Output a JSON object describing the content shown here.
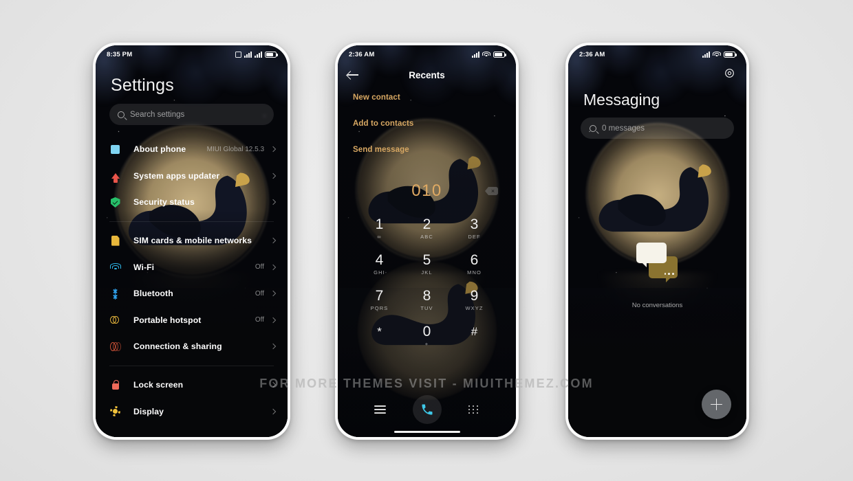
{
  "watermark": "FOR MORE THEMES VISIT - MIUITHEMEZ.COM",
  "settings_phone": {
    "status": {
      "time": "8:35 PM",
      "sim_icon": "sim-card-icon",
      "signal1": "signal-bars-icon",
      "signal2": "signal-bars-icon",
      "battery": "battery-icon"
    },
    "title": "Settings",
    "search": {
      "placeholder": "Search settings",
      "icon": "search-icon"
    },
    "items": [
      {
        "label": "About phone",
        "value": "MIUI Global 12.5.3",
        "icon": "about-phone-icon"
      },
      {
        "label": "System apps updater",
        "value": "",
        "icon": "system-update-icon"
      },
      {
        "label": "Security status",
        "value": "",
        "icon": "security-shield-icon"
      },
      {
        "label": "SIM cards & mobile networks",
        "value": "",
        "icon": "sim-card-icon"
      },
      {
        "label": "Wi-Fi",
        "value": "Off",
        "icon": "wifi-icon"
      },
      {
        "label": "Bluetooth",
        "value": "Off",
        "icon": "bluetooth-icon"
      },
      {
        "label": "Portable hotspot",
        "value": "Off",
        "icon": "hotspot-icon"
      },
      {
        "label": "Connection & sharing",
        "value": "",
        "icon": "connection-sharing-icon"
      },
      {
        "label": "Lock screen",
        "value": "",
        "icon": "lock-icon"
      },
      {
        "label": "Display",
        "value": "",
        "icon": "display-brightness-icon"
      }
    ]
  },
  "dialer_phone": {
    "status": {
      "time": "2:36 AM",
      "signal": "signal-bars-icon",
      "wifi": "wifi-icon",
      "battery": "battery-icon"
    },
    "header": {
      "title": "Recents",
      "back_icon": "back-arrow-icon"
    },
    "actions": [
      "New contact",
      "Add to contacts",
      "Send message"
    ],
    "number": "010",
    "backspace_icon": "backspace-icon",
    "keys": [
      {
        "digit": "1",
        "letters": "∞"
      },
      {
        "digit": "2",
        "letters": "ABC"
      },
      {
        "digit": "3",
        "letters": "DEF"
      },
      {
        "digit": "4",
        "letters": "GHI"
      },
      {
        "digit": "5",
        "letters": "JKL"
      },
      {
        "digit": "6",
        "letters": "MNO"
      },
      {
        "digit": "7",
        "letters": "PQRS"
      },
      {
        "digit": "8",
        "letters": "TUV"
      },
      {
        "digit": "9",
        "letters": "WXYZ"
      },
      {
        "digit": "*",
        "letters": ""
      },
      {
        "digit": "0",
        "letters": "+"
      },
      {
        "digit": "#",
        "letters": ""
      }
    ],
    "nav": {
      "menu_icon": "menu-lines-icon",
      "call_icon": "phone-call-icon",
      "keypad_icon": "keypad-grid-icon"
    }
  },
  "messaging_phone": {
    "status": {
      "time": "2:36 AM",
      "signal": "signal-bars-icon",
      "wifi": "wifi-icon",
      "battery": "battery-icon"
    },
    "settings_icon": "gear-icon",
    "title": "Messaging",
    "search": {
      "placeholder": "0 messages",
      "icon": "search-icon"
    },
    "empty_state": {
      "text": "No conversations",
      "icon": "chat-bubbles-icon"
    },
    "fab": {
      "icon": "plus-icon",
      "label": "New conversation"
    }
  },
  "colors": {
    "background": "#e9e9e9",
    "accent_gold": "#d8a863",
    "number_gold": "#e0aa63",
    "call_cyan": "#3ec8e8",
    "screen_black": "#06070a"
  }
}
